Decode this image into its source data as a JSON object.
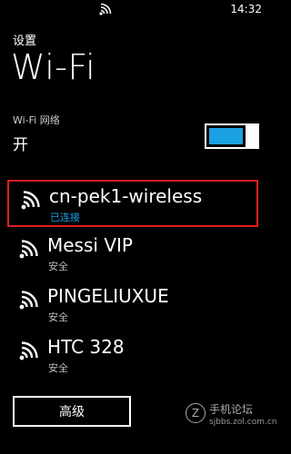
{
  "status_bar": {
    "time": "14:32",
    "signal_icon": "wifi-signal-icon"
  },
  "header": {
    "section": "设置",
    "title": "Wi-Fi"
  },
  "wifi_setting": {
    "label": "Wi-Fi 网络",
    "state": "开",
    "enabled": true
  },
  "networks": [
    {
      "name": "cn-pek1-wireless",
      "status": "已连接",
      "icon": "wifi-signal-icon",
      "selected": true
    },
    {
      "name": "Messi VIP",
      "status": "安全",
      "icon": "wifi-signal-icon"
    },
    {
      "name": "PINGELIUXUE",
      "status": "安全",
      "icon": "wifi-signal-icon"
    },
    {
      "name": "HTC 328",
      "status": "安全",
      "icon": "wifi-signal-icon"
    }
  ],
  "advanced_button": {
    "label": "高级"
  },
  "watermark": {
    "name": "手机论坛",
    "url": "sjbbs.zol.com.cn"
  },
  "colors": {
    "accent": "#1ba1e2",
    "highlight": "#e02020",
    "background": "#000000"
  }
}
